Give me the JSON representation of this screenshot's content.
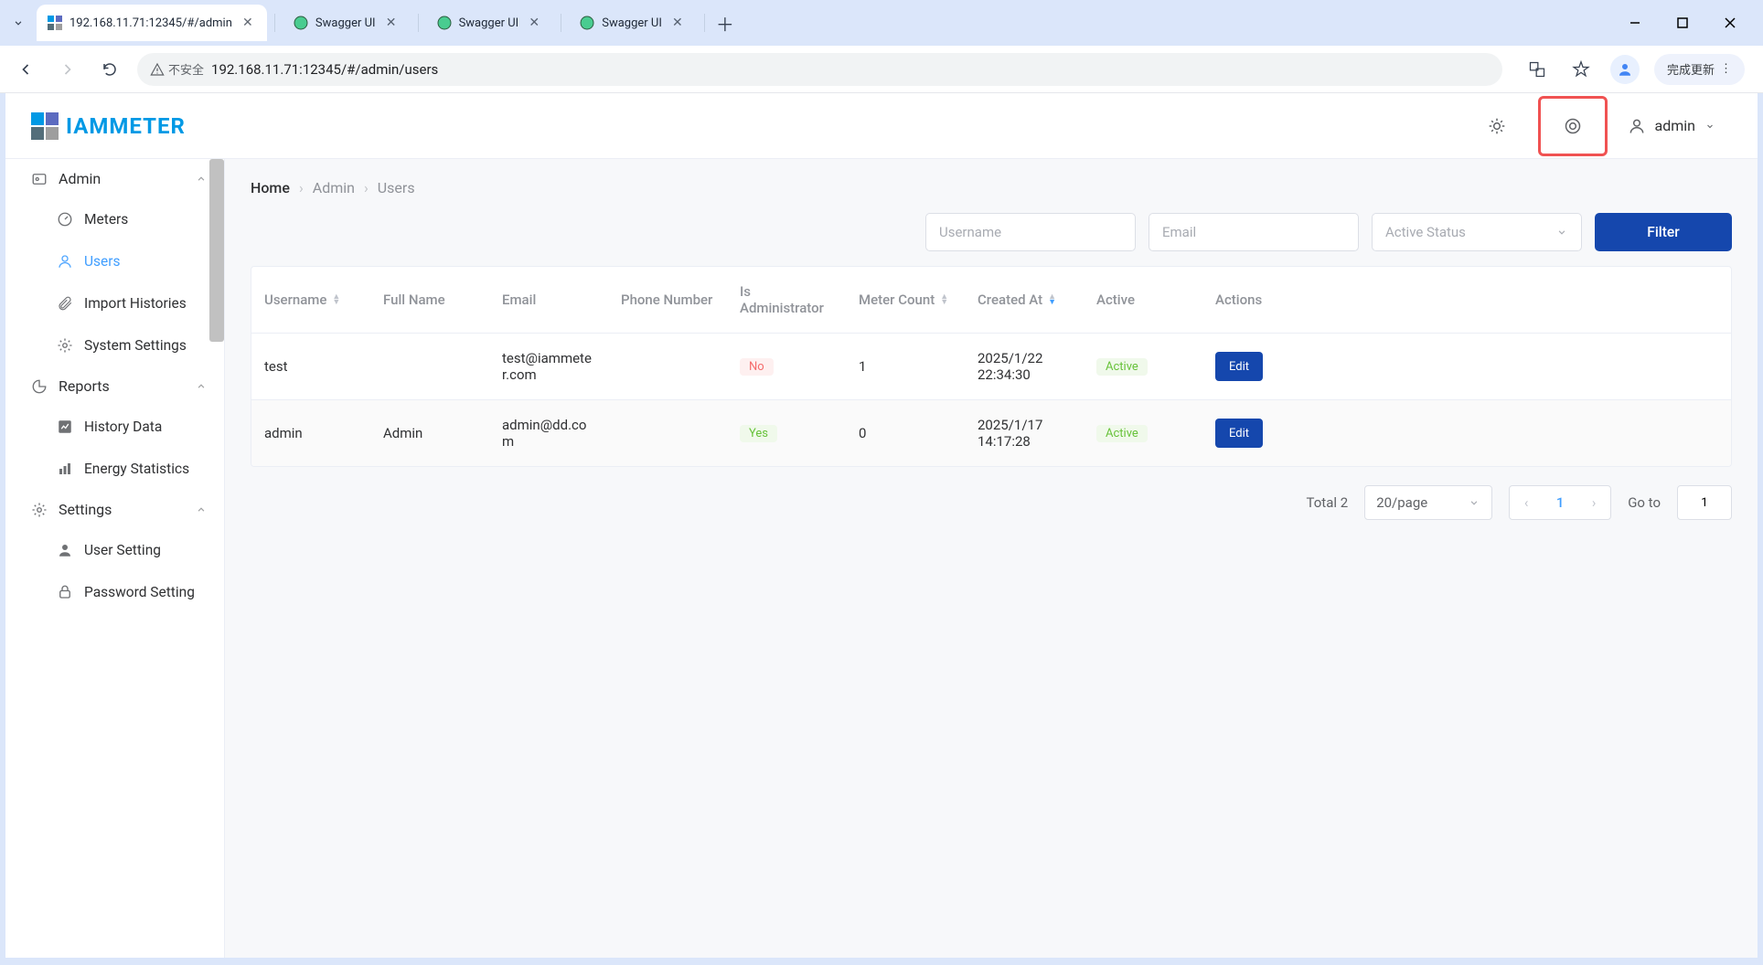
{
  "browser": {
    "tabs": [
      {
        "title": "192.168.11.71:12345/#/admin",
        "active": true,
        "icon": "iammeter"
      },
      {
        "title": "Swagger UI",
        "active": false,
        "icon": "swagger"
      },
      {
        "title": "Swagger UI",
        "active": false,
        "icon": "swagger"
      },
      {
        "title": "Swagger UI",
        "active": false,
        "icon": "swagger"
      }
    ],
    "insecure_label": "不安全",
    "url": "192.168.11.71:12345/#/admin/users",
    "update_label": "完成更新"
  },
  "header": {
    "logo_text": "IAMMETER",
    "user_name": "admin"
  },
  "sidebar": {
    "groups": [
      {
        "label": "Admin",
        "items": [
          {
            "label": "Meters",
            "icon": "meter-icon"
          },
          {
            "label": "Users",
            "icon": "user-icon",
            "active": true
          },
          {
            "label": "Import Histories",
            "icon": "attach-icon"
          },
          {
            "label": "System Settings",
            "icon": "gear-icon"
          }
        ]
      },
      {
        "label": "Reports",
        "items": [
          {
            "label": "History Data",
            "icon": "chart-icon"
          },
          {
            "label": "Energy Statistics",
            "icon": "bar-icon"
          }
        ]
      },
      {
        "label": "Settings",
        "items": [
          {
            "label": "User Setting",
            "icon": "person-icon"
          },
          {
            "label": "Password Setting",
            "icon": "lock-icon"
          }
        ]
      }
    ]
  },
  "breadcrumb": [
    "Home",
    "Admin",
    "Users"
  ],
  "filters": {
    "username_placeholder": "Username",
    "email_placeholder": "Email",
    "active_status_placeholder": "Active Status",
    "filter_button": "Filter"
  },
  "table": {
    "columns": [
      "Username",
      "Full Name",
      "Email",
      "Phone Number",
      "Is Administrator",
      "Meter Count",
      "Created At",
      "Active",
      "Actions"
    ],
    "rows": [
      {
        "username": "test",
        "full_name": "",
        "email": "test@iammeter.com",
        "phone": "",
        "is_admin": "No",
        "meter_count": "1",
        "created_at": "2025/1/22 22:34:30",
        "active": "Active",
        "action": "Edit"
      },
      {
        "username": "admin",
        "full_name": "Admin",
        "email": "admin@dd.com",
        "phone": "",
        "is_admin": "Yes",
        "meter_count": "0",
        "created_at": "2025/1/17 14:17:28",
        "active": "Active",
        "action": "Edit"
      }
    ]
  },
  "pagination": {
    "total_label": "Total 2",
    "page_size": "20/page",
    "current_page": "1",
    "goto_label": "Go to",
    "goto_value": "1"
  }
}
